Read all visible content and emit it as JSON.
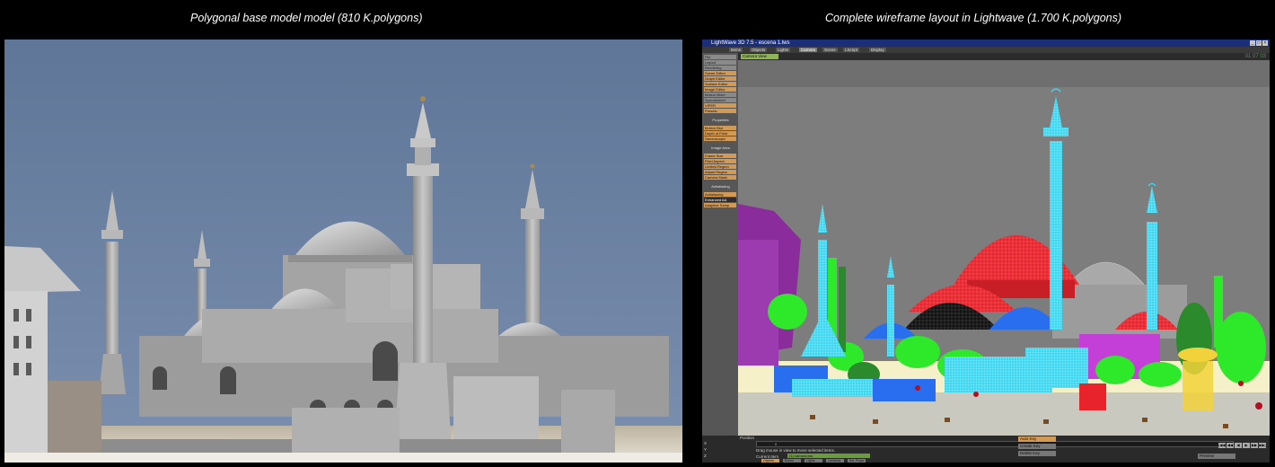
{
  "captions": {
    "left": "Polygonal base model model (810 K.polygons)",
    "right": "Complete wireframe layout in Lightwave (1.700 K.polygons)"
  },
  "lightwave": {
    "title": "LightWave 3D 7.5 - escena 1.lws",
    "window_buttons": [
      "_",
      "□",
      "×"
    ],
    "tabs": [
      "Items",
      "Objects",
      "Lights",
      "Camera",
      "Scene",
      "LScript",
      "Display"
    ],
    "active_tab": "Camera",
    "view_select": "Camera View",
    "frame_readout": "01 07 03",
    "sidebar": [
      {
        "label": "File",
        "style": "gray"
      },
      {
        "label": "Layout",
        "style": "gray"
      },
      {
        "label": "Rendering",
        "style": "gray"
      },
      {
        "label": "Scene Editor",
        "style": "orange"
      },
      {
        "label": "Graph Editor",
        "style": "orange"
      },
      {
        "label": "Surface Editor",
        "style": "orange"
      },
      {
        "label": "Image Editor",
        "style": "orange"
      },
      {
        "label": "Motion Mixer",
        "style": "gray"
      },
      {
        "label": "Spreadsheet",
        "style": "gray"
      },
      {
        "label": "VIPER",
        "style": "orange"
      },
      {
        "label": "Presets",
        "style": "orange"
      },
      {
        "label": "Properties",
        "style": "head"
      },
      {
        "label": "Motion Blur",
        "style": "orange"
      },
      {
        "label": "Depth of Field",
        "style": "orange"
      },
      {
        "label": "Stereoscopic",
        "style": "orange"
      },
      {
        "label": "Image Area",
        "style": "head"
      },
      {
        "label": "Frame Size",
        "style": "orange"
      },
      {
        "label": "Pixel Aspect",
        "style": "orange"
      },
      {
        "label": "Limited Region",
        "style": "orange"
      },
      {
        "label": "Adjust Region",
        "style": "orange"
      },
      {
        "label": "Camera Mask",
        "style": "orange"
      },
      {
        "label": "Antialiasing",
        "style": "head"
      },
      {
        "label": "Antialiasing",
        "style": "orange"
      },
      {
        "label": "Enhanced AA",
        "style": "dark"
      },
      {
        "label": "Adaptive Samp",
        "style": "orange"
      }
    ],
    "bottom": {
      "position_label": "Position",
      "axes": [
        "X",
        "Y",
        "Z"
      ],
      "frame_value": "0",
      "status_text": "Drag mouse in view to move selected items.",
      "current_item_label": "Current Item",
      "current_item": "(1) camara.lws",
      "buttons": [
        "Objects",
        "Bones",
        "Lights",
        "Cameras",
        "Sel. Props"
      ],
      "auto_key": "Auto Key",
      "create_key": "Create Key",
      "delete_key": "Delete Key",
      "preview": "Preview",
      "play_buttons": [
        "|◀◀",
        "◀◀",
        "◀",
        "▶",
        "▶▶",
        "▶▶|"
      ]
    }
  },
  "colors": {
    "sky_left": "#6d84a6",
    "wire_cyan": "#3fd6f0",
    "wire_red": "#e8232c",
    "wire_green": "#2ee82a",
    "wire_blue": "#2a6ef0",
    "wire_magenta": "#c43fd8",
    "wire_yellow": "#f2d23a",
    "wire_purple": "#8a2c9c",
    "ground_cream": "#f5f0c8"
  }
}
